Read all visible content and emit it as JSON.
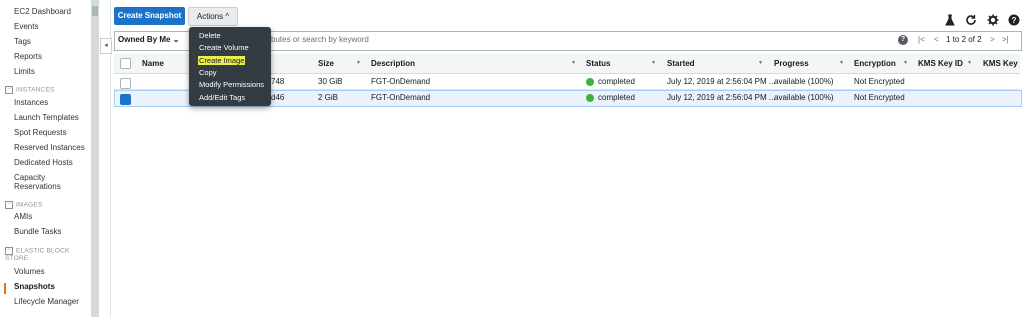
{
  "sidebar": {
    "top_items": [
      "EC2 Dashboard",
      "Events",
      "Tags",
      "Reports",
      "Limits"
    ],
    "instances_section": "INSTANCES",
    "instances_items": [
      "Instances",
      "Launch Templates",
      "Spot Requests",
      "Reserved Instances",
      "Dedicated Hosts"
    ],
    "capacity_line1": "Capacity",
    "capacity_line2": "Reservations",
    "images_section": "IMAGES",
    "images_items": [
      "AMIs",
      "Bundle Tasks"
    ],
    "ebs_section_line1": "ELASTIC BLOCK",
    "ebs_section_line2": "STORE",
    "ebs_items": [
      "Volumes",
      "Snapshots",
      "Lifecycle Manager"
    ],
    "section_toggle": "−",
    "active_item": "Snapshots"
  },
  "toolbar": {
    "create_label": "Create Snapshot",
    "actions_label": "Actions",
    "actions_caret": "^",
    "icons": [
      "flask-icon",
      "refresh-icon",
      "gear-icon",
      "help-icon"
    ]
  },
  "filter": {
    "owned_label": "Owned By Me",
    "owned_caret": "⌄",
    "search_placeholder": "butes or search by keyword",
    "help": "?",
    "pager_text": "1 to 2 of 2",
    "nav_first": "|<",
    "nav_prev": "<",
    "nav_next": ">",
    "nav_last": ">|",
    "collapse": "◂"
  },
  "table": {
    "columns": [
      "Name",
      "Size",
      "Description",
      "Status",
      "Started",
      "Progress",
      "Encryption",
      "KMS Key ID",
      "KMS Key A"
    ],
    "sort_glyph": "▾",
    "rows": [
      {
        "id_tail": "748",
        "size": "30 GiB",
        "description": "FGT-OnDemand",
        "status": "completed",
        "started": "July 12, 2019 at 2:56:04 PM ...",
        "progress": "available (100%)",
        "encryption": "Not Encrypted",
        "selected": false
      },
      {
        "id_tail": "d46",
        "size": "2 GiB",
        "description": "FGT-OnDemand",
        "status": "completed",
        "started": "July 12, 2019 at 2:56:04 PM ...",
        "progress": "available (100%)",
        "encryption": "Not Encrypted",
        "selected": true
      }
    ]
  },
  "actions_menu": {
    "items": [
      "Delete",
      "Create Volume",
      "Create Image",
      "Copy",
      "Modify Permissions",
      "Add/Edit Tags"
    ],
    "highlighted": "Create Image"
  },
  "colors": {
    "primary": "#1a73c8",
    "active_accent": "#ec7211",
    "status_green": "#3cb43c",
    "menu_bg": "#333c43",
    "highlight": "#e9ee4b"
  }
}
